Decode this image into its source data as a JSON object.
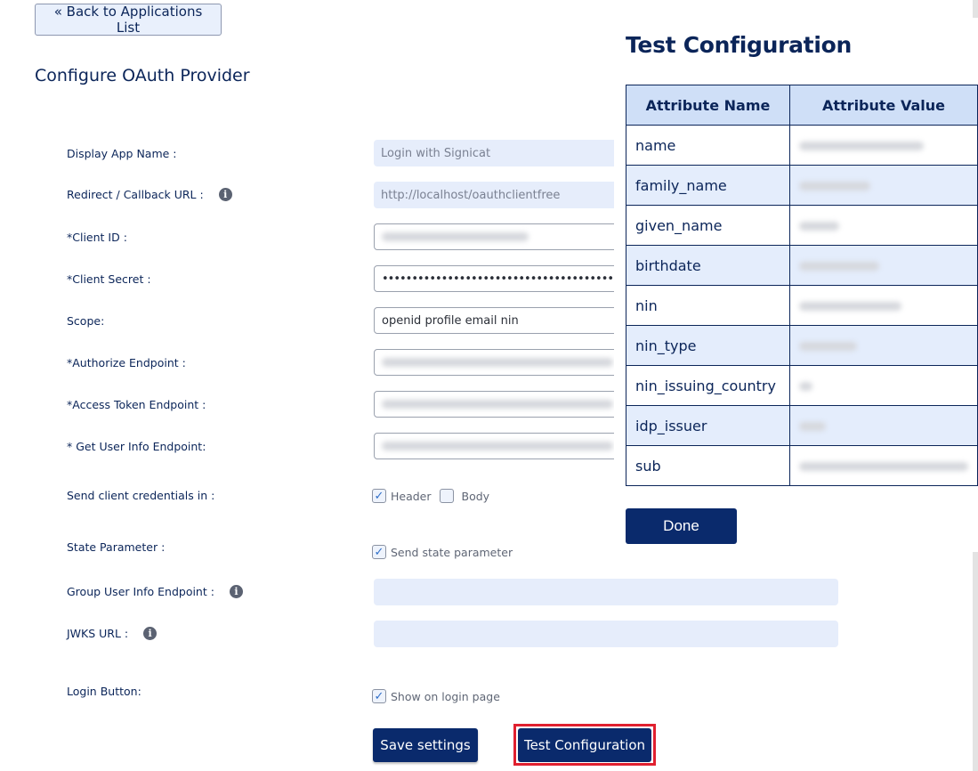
{
  "back_button": "« Back to Applications List",
  "page_title": "Configure OAuth Provider",
  "form": {
    "display_app_name": {
      "label": "Display App Name :",
      "value": "Login with Signicat"
    },
    "redirect_url": {
      "label": "Redirect / Callback URL :",
      "value": "http://localhost/oauthclientfree",
      "icon": "info-icon"
    },
    "client_id": {
      "label": "*Client ID :",
      "value": "[redacted]"
    },
    "client_secret": {
      "label": "*Client Secret :",
      "value": "•••••••••••••••••••••••••••••••••••••••••"
    },
    "scope": {
      "label": "Scope:",
      "value": "openid profile email nin"
    },
    "authorize_endpoint": {
      "label": "*Authorize Endpoint :",
      "value": "[redacted]"
    },
    "access_token_endpoint": {
      "label": "*Access Token Endpoint :",
      "value": "[redacted]"
    },
    "user_info_endpoint": {
      "label": "* Get User Info Endpoint:",
      "value": "[redacted]"
    },
    "send_credentials": {
      "label": "Send client credentials in :",
      "options": [
        {
          "label": "Header",
          "checked": true
        },
        {
          "label": "Body",
          "checked": false
        }
      ]
    },
    "state_parameter": {
      "label": "State Parameter :",
      "option": {
        "label": "Send state parameter",
        "checked": true
      }
    },
    "group_user_info_endpoint": {
      "label": "Group User Info Endpoint :",
      "value": "",
      "icon": "info-icon"
    },
    "jwks_url": {
      "label": "JWKS URL :",
      "value": "",
      "icon": "info-icon"
    },
    "login_button": {
      "label": "Login Button:",
      "option": {
        "label": "Show on login page",
        "checked": true
      }
    }
  },
  "buttons": {
    "save": "Save settings",
    "test": "Test Configuration"
  },
  "popup": {
    "title": "Test Configuration",
    "columns": [
      "Attribute Name",
      "Attribute Value"
    ],
    "rows": [
      {
        "name": "name",
        "value": "[redacted]"
      },
      {
        "name": "family_name",
        "value": "[redacted]"
      },
      {
        "name": "given_name",
        "value": "[redacted]"
      },
      {
        "name": "birthdate",
        "value": "[redacted]"
      },
      {
        "name": "nin",
        "value": "[redacted]"
      },
      {
        "name": "nin_type",
        "value": "[redacted]"
      },
      {
        "name": "nin_issuing_country",
        "value": "[redacted]"
      },
      {
        "name": "idp_issuer",
        "value": "[redacted]"
      },
      {
        "name": "sub",
        "value": "[redacted]"
      }
    ],
    "done": "Done"
  },
  "colors": {
    "primary": "#0a2a6c",
    "text": "#0b2559",
    "highlight": "#e0202f",
    "readonly_bg": "#e6edfb",
    "table_header_bg": "#cfdff7"
  }
}
